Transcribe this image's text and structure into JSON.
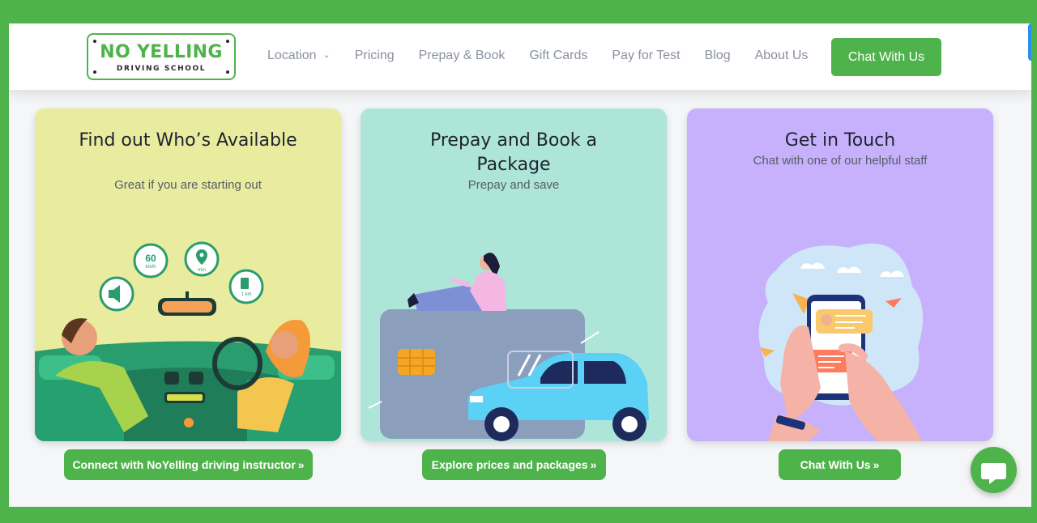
{
  "logo": {
    "title": "NO YELLING",
    "subtitle": "DRIVING SCHOOL"
  },
  "nav": {
    "items": [
      {
        "label": "Location",
        "has_dropdown": true
      },
      {
        "label": "Pricing"
      },
      {
        "label": "Prepay & Book"
      },
      {
        "label": "Gift Cards"
      },
      {
        "label": "Pay for Test"
      },
      {
        "label": "Blog"
      },
      {
        "label": "About Us"
      }
    ],
    "cta_label": "Chat With Us"
  },
  "cards": [
    {
      "title": "Find out Who’s Available",
      "subtitle": "Great if you are starting out",
      "button": "Connect with NoYelling driving instructor",
      "bg_color": "#e9ec9f",
      "dashboard": {
        "speed": "60",
        "speed_unit": "km/h",
        "time_unit": "min",
        "fuel_unit": "1 km"
      }
    },
    {
      "title": "Prepay and Book a Package",
      "subtitle": "Prepay and save",
      "button": "Explore prices and packages",
      "bg_color": "#ade5d9"
    },
    {
      "title": "Get in Touch",
      "subtitle": "Chat with one of our helpful staff",
      "button": "Chat With Us",
      "bg_color": "#c7b1fc"
    }
  ],
  "colors": {
    "brand_green": "#4fb34c",
    "page_bg": "#f4f6f8"
  },
  "icons": {
    "chevron": "»",
    "nav_caret": "⌄",
    "floating_chat": "chat-bubble-icon"
  }
}
